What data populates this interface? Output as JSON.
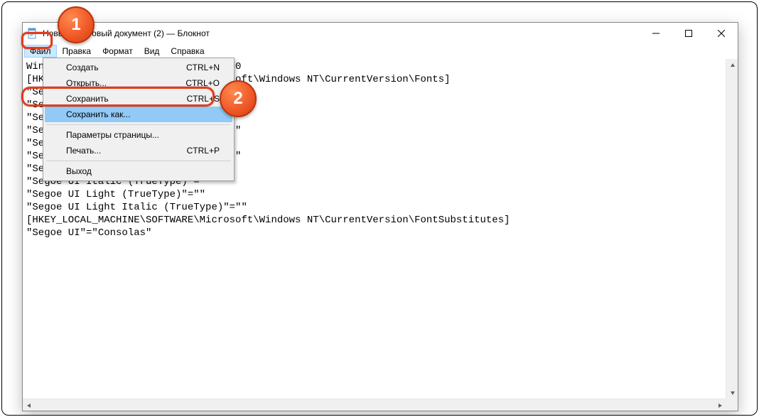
{
  "window": {
    "title": "Новый текстовый документ (2) — Блокнот"
  },
  "menubar": {
    "file": "Файл",
    "edit": "Правка",
    "format": "Формат",
    "view": "Вид",
    "help": "Справка"
  },
  "file_menu": {
    "new": {
      "label": "Создать",
      "shortcut": "CTRL+N"
    },
    "open": {
      "label": "Открыть...",
      "shortcut": "CTRL+O"
    },
    "save": {
      "label": "Сохранить",
      "shortcut": "CTRL+S"
    },
    "save_as": {
      "label": "Сохранить как...",
      "shortcut": ""
    },
    "page_setup": {
      "label": "Параметры страницы...",
      "shortcut": ""
    },
    "print": {
      "label": "Печать...",
      "shortcut": "CTRL+P"
    },
    "exit": {
      "label": "Выход",
      "shortcut": ""
    }
  },
  "document": {
    "text": "Windows Registry Editor Version 5.00\n[HKEY_LOCAL_MACHINE\\SOFTWARE\\Microsoft\\Windows NT\\CurrentVersion\\Fonts]\n\"Segoe UI (TrueType)\"=\"\"\n\"Segoe UI (TrueType)\"=\"\"\n\"Segoe UI Black (TrueType)\"=\"\"\n\"Segoe UI Black Italic(TrueType)\"=\"\"\n\"Segoe UI Bold (TrueType)\"=\"\"\n\"Segoe UI Bold Italic (TrueType)\"=\"\"\n\"Segoe UI Historic (TrueType)\"=\"\"\n\"Segoe UI Italic (TrueType)\"=\"\"\n\"Segoe UI Light (TrueType)\"=\"\"\n\"Segoe UI Light Italic (TrueType)\"=\"\"\n[HKEY_LOCAL_MACHINE\\SOFTWARE\\Microsoft\\Windows NT\\CurrentVersion\\FontSubstitutes]\n\"Segoe UI\"=\"Consolas\""
  },
  "badges": {
    "one": "1",
    "two": "2"
  }
}
